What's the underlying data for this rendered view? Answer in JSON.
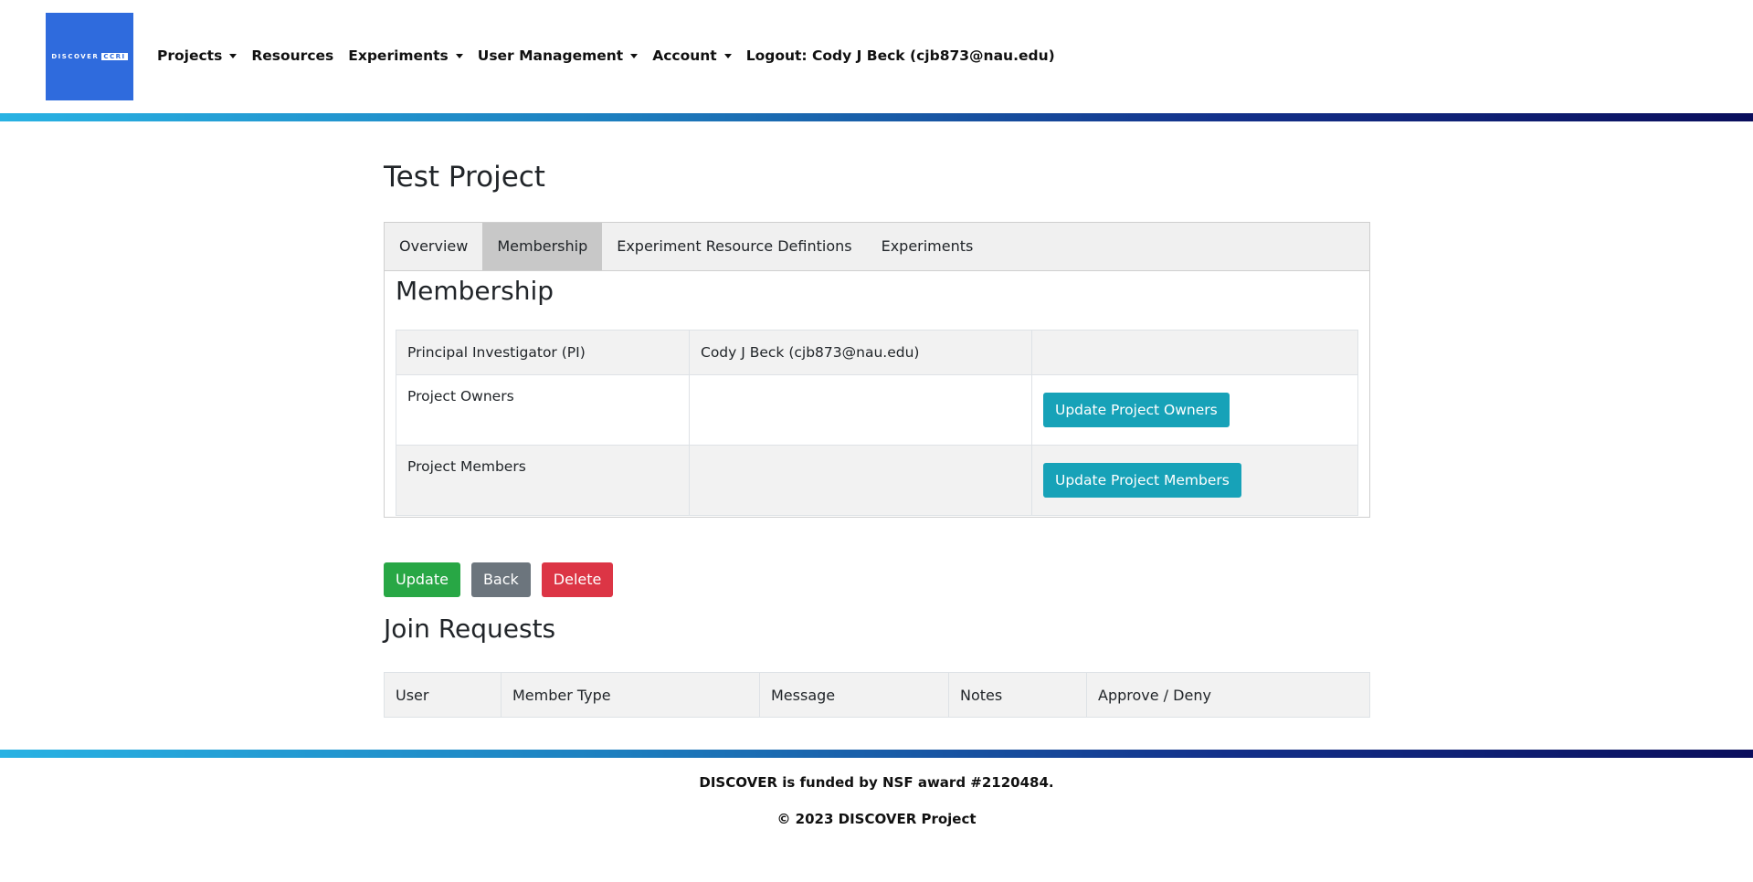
{
  "logo": {
    "text": "DISCOVER",
    "boxed": "CCRI"
  },
  "nav": {
    "projects": "Projects",
    "resources": "Resources",
    "experiments": "Experiments",
    "user_management": "User Management",
    "account": "Account",
    "logout": "Logout: Cody J Beck (cjb873@nau.edu)"
  },
  "page": {
    "title": "Test Project"
  },
  "tabs": [
    "Overview",
    "Membership",
    "Experiment Resource Defintions",
    "Experiments"
  ],
  "membership": {
    "title": "Membership",
    "rows": [
      {
        "label": "Principal Investigator (PI)",
        "value": "Cody J Beck (cjb873@nau.edu)"
      },
      {
        "label": "Project Owners",
        "value": "",
        "button": "Update Project Owners"
      },
      {
        "label": "Project Members",
        "value": "",
        "button": "Update Project Members"
      }
    ]
  },
  "actions": {
    "update": "Update",
    "back": "Back",
    "delete": "Delete"
  },
  "join_requests": {
    "title": "Join Requests",
    "columns": [
      "User",
      "Member Type",
      "Message",
      "Notes",
      "Approve / Deny"
    ]
  },
  "footer": {
    "line1": "DISCOVER is funded by NSF award #2120484.",
    "line2": "© 2023 DISCOVER Project"
  },
  "colors": {
    "logo_bg": "#2f6bdd",
    "update": "#28a745",
    "back": "#6c757d",
    "delete": "#dc3545",
    "info": "#17a2b8",
    "band_start": "#28b2e3",
    "band_end": "#0a0e5c"
  }
}
